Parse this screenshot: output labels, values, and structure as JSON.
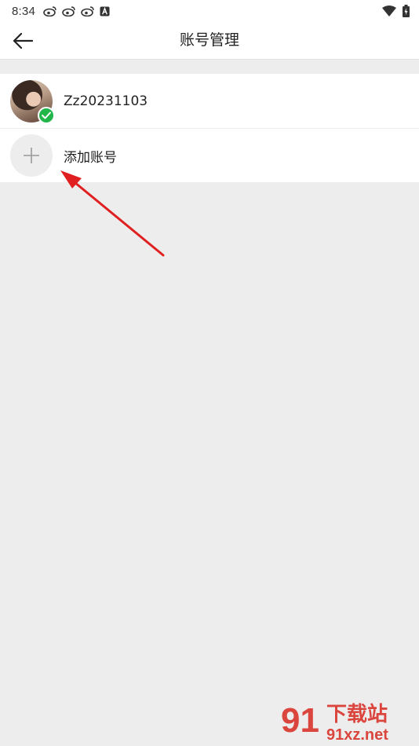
{
  "status_bar": {
    "time": "8:34",
    "left_icons": [
      "weibo-icon",
      "weibo-icon",
      "weibo-icon",
      "a-icon"
    ],
    "right_icons": [
      "wifi-icon",
      "battery-icon"
    ]
  },
  "header": {
    "title": "账号管理",
    "back_icon": "arrow-left-icon"
  },
  "accounts": [
    {
      "name": "Zz20231103",
      "active": true
    }
  ],
  "add_account": {
    "label": "添加账号",
    "icon": "plus-icon"
  },
  "annotation": {
    "arrow_color": "#e02020"
  },
  "watermark": {
    "brand": "91下载站",
    "url": "91xz.net",
    "color": "#d9342b"
  },
  "colors": {
    "background": "#ededed",
    "surface": "#ffffff",
    "check_badge": "#22b64a"
  }
}
